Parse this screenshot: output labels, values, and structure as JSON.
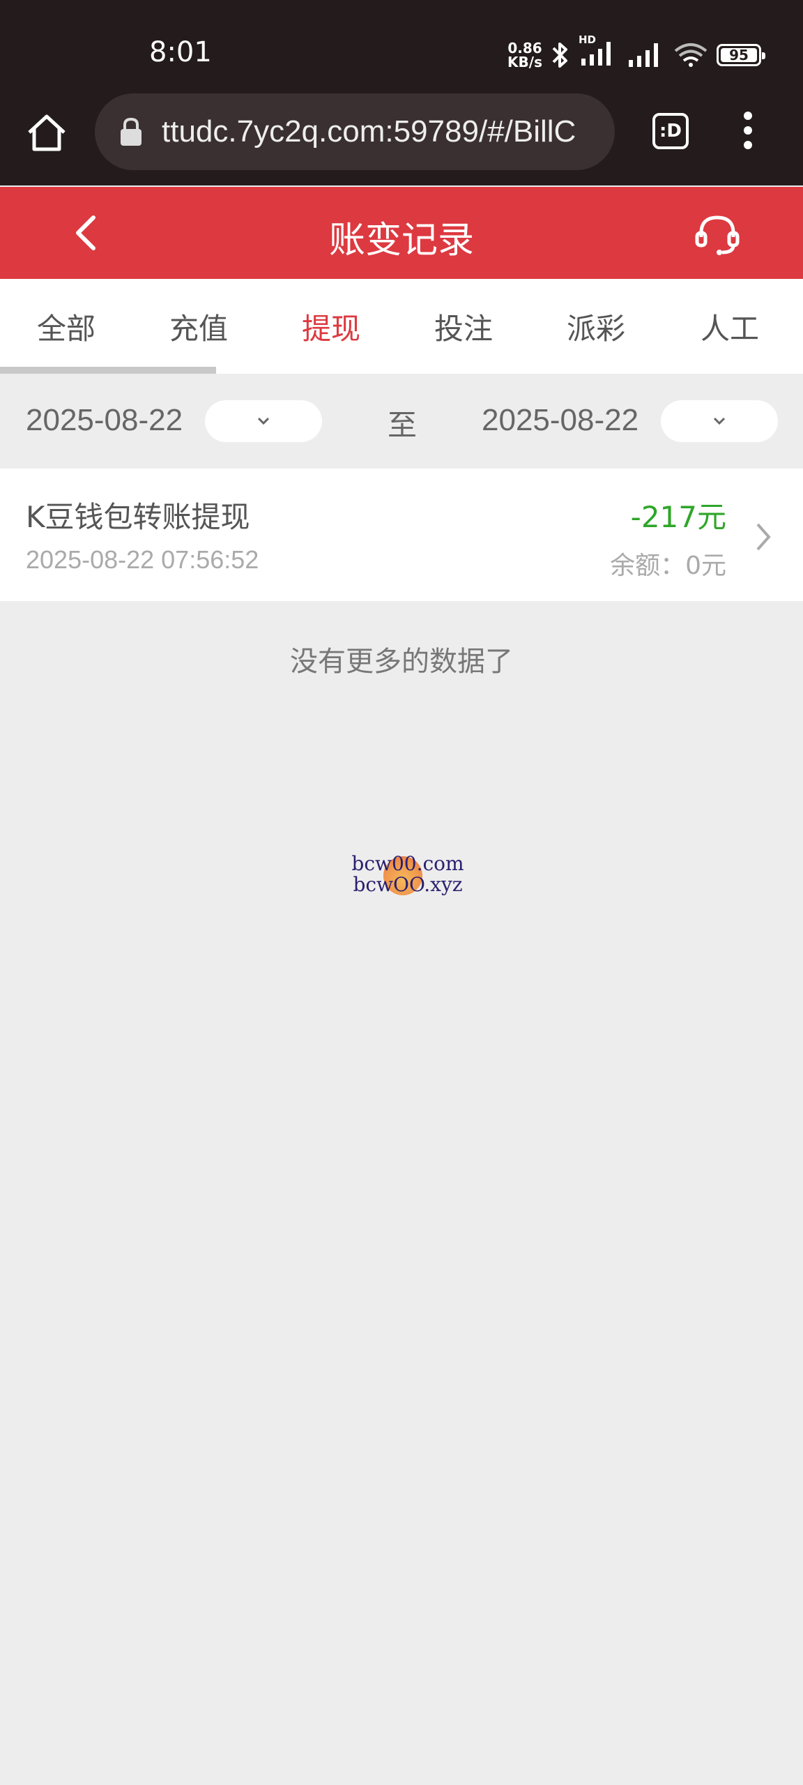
{
  "status_bar": {
    "time": "8:01",
    "net_speed_value": "0.86",
    "net_speed_unit": "KB/s",
    "hd_label": "HD",
    "battery": "95"
  },
  "browser": {
    "url": "ttudc.7yc2q.com:59789/#/BillC",
    "tab_switch_label": ":D"
  },
  "header": {
    "title": "账变记录"
  },
  "tabs": [
    {
      "label": "全部"
    },
    {
      "label": "充值"
    },
    {
      "label": "提现"
    },
    {
      "label": "投注"
    },
    {
      "label": "派彩"
    },
    {
      "label": "人工"
    }
  ],
  "active_tab": "提现",
  "filter": {
    "start_date": "2025-08-22",
    "to_label": "至",
    "end_date": "2025-08-22"
  },
  "records": [
    {
      "title": "K豆钱包转账提现",
      "time": "2025-08-22 07:56:52",
      "amount": "-217元",
      "balance": "余额：0元"
    }
  ],
  "no_more_text": "没有更多的数据了",
  "watermark": {
    "line1": "bcw00.com",
    "line2": "bcwOO.xyz"
  },
  "colors": {
    "header_red": "#dd3940",
    "amount_green": "#2fa62a",
    "status_bg": "#231b1c"
  }
}
